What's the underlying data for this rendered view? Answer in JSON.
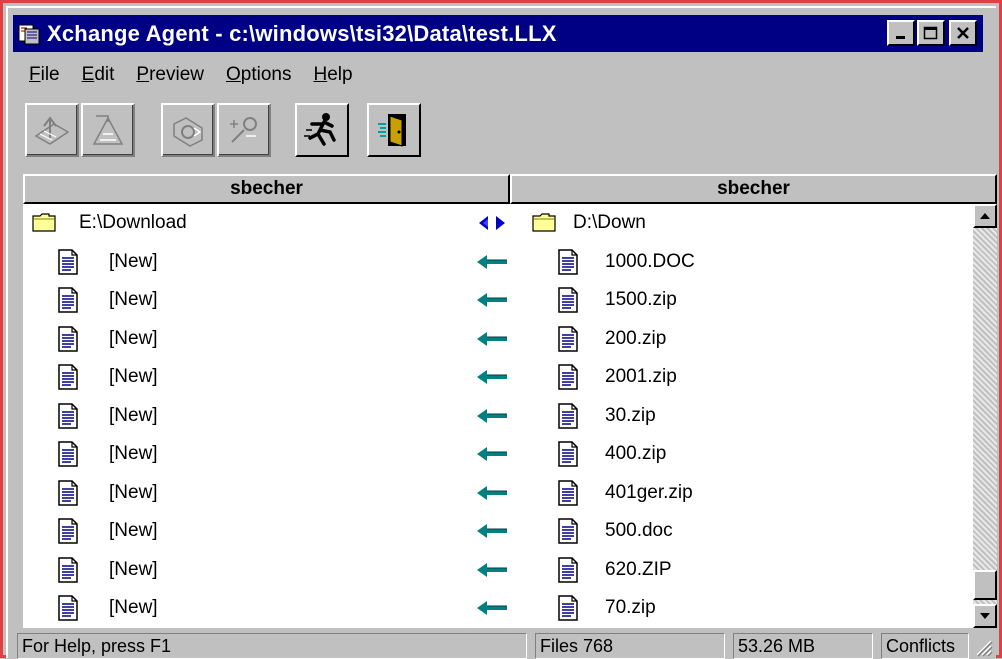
{
  "window": {
    "title": "Xchange Agent - c:\\windows\\tsi32\\Data\\test.LLX",
    "title_icon": "xchange-app-icon",
    "controls": [
      "minimize-icon",
      "maximize-icon",
      "close-icon"
    ]
  },
  "menu": [
    {
      "label": "File",
      "accel": "F",
      "rest": "ile"
    },
    {
      "label": "Edit",
      "accel": "E",
      "rest": "dit"
    },
    {
      "label": "Preview",
      "accel": "P",
      "rest": "review"
    },
    {
      "label": "Options",
      "accel": "O",
      "rest": "ptions"
    },
    {
      "label": "Help",
      "accel": "H",
      "rest": "elp"
    }
  ],
  "toolbar": {
    "icons": [
      "upload-disabled-icon",
      "download-disabled-icon",
      "preview-disabled-icon",
      "settings-disabled-icon",
      "run-icon",
      "exit-door-icon"
    ]
  },
  "columns": {
    "left_header": "sbecher",
    "right_header": "sbecher"
  },
  "rows": [
    {
      "left": "E:\\Download",
      "right": "D:\\Down",
      "type": "folder",
      "arrow": "sync-both"
    },
    {
      "left": "[New]",
      "right": "1000.DOC",
      "type": "file",
      "arrow": "left"
    },
    {
      "left": "[New]",
      "right": "1500.zip",
      "type": "file",
      "arrow": "left"
    },
    {
      "left": "[New]",
      "right": "200.zip",
      "type": "file",
      "arrow": "left"
    },
    {
      "left": "[New]",
      "right": "2001.zip",
      "type": "file",
      "arrow": "left"
    },
    {
      "left": "[New]",
      "right": "30.zip",
      "type": "file",
      "arrow": "left"
    },
    {
      "left": "[New]",
      "right": "400.zip",
      "type": "file",
      "arrow": "left"
    },
    {
      "left": "[New]",
      "right": "401ger.zip",
      "type": "file",
      "arrow": "left"
    },
    {
      "left": "[New]",
      "right": "500.doc",
      "type": "file",
      "arrow": "left"
    },
    {
      "left": "[New]",
      "right": "620.ZIP",
      "type": "file",
      "arrow": "left"
    },
    {
      "left": "[New]",
      "right": "70.zip",
      "type": "file",
      "arrow": "left"
    }
  ],
  "status": {
    "help": "For Help, press F1",
    "files": "Files 768",
    "size": "53.26 MB",
    "conflicts": "Conflicts"
  },
  "colors": {
    "titlebar": "#000084",
    "face": "#c0c0c0",
    "arrow": "#008080",
    "folder": "#ffff99"
  }
}
